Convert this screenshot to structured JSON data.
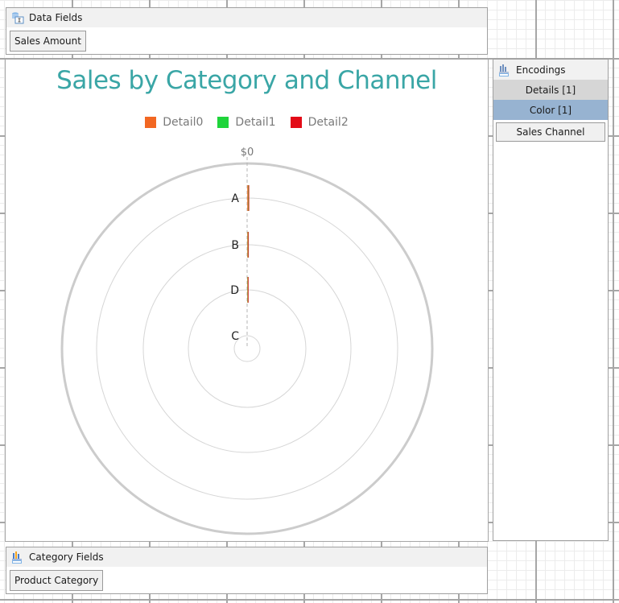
{
  "data_fields": {
    "title": "Data Fields",
    "icon": "data-source-icon",
    "items": [
      "Sales Amount"
    ]
  },
  "category_fields": {
    "title": "Category Fields",
    "icon": "bar-chart-icon",
    "items": [
      "Product Category"
    ]
  },
  "encodings": {
    "title": "Encodings",
    "icon": "bar-chart-icon",
    "details_label": "Details [1]",
    "color_label": "Color [1]",
    "items": [
      "Sales Channel"
    ]
  },
  "colors": {
    "title": "#3aa6a6",
    "detail0": "#f26722",
    "detail1": "#1fd43b",
    "detail2": "#e30b17",
    "selected_encoding": "#97b3d1"
  },
  "chart_data": {
    "type": "bar",
    "subtype": "radial-stacked-bar",
    "title": "Sales by Category and Channel",
    "categories": [
      "A",
      "B",
      "D",
      "C"
    ],
    "series": [
      {
        "name": "Detail0",
        "color": "#f26722",
        "values": [
          0.3,
          0.2,
          0.15,
          0
        ]
      },
      {
        "name": "Detail1",
        "color": "#1fd43b",
        "values": [
          0.02,
          0.03,
          0.01,
          0
        ]
      },
      {
        "name": "Detail2",
        "color": "#e30b17",
        "values": [
          0.01,
          0.02,
          0.01,
          0
        ]
      }
    ],
    "angular_axis": {
      "tick_labels": [
        "$0"
      ]
    },
    "radial_axis": {
      "labels": [
        "A",
        "B",
        "D",
        "C"
      ]
    },
    "legend": {
      "position": "top",
      "entries": [
        "Detail0",
        "Detail1",
        "Detail2"
      ]
    },
    "grid": true
  }
}
